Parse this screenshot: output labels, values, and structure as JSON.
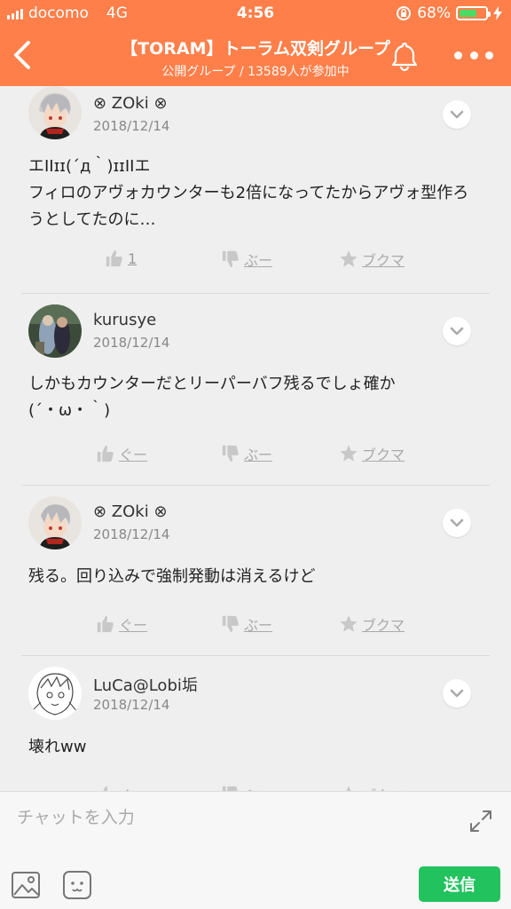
{
  "status_bar": {
    "carrier": "docomo",
    "network": "4G",
    "time": "4:56",
    "battery_percent": "68%",
    "battery_level": 0.68
  },
  "header": {
    "title": "【TORAM】トーラム双剣グループ",
    "subtitle": "公開グループ / 13589人が参加中",
    "back_icon": "chevron-left-icon",
    "bell_icon": "bell-icon",
    "more_icon": "more-dots-icon"
  },
  "posts": [
    {
      "username": "⊗ ZOki ⊗",
      "date": "2018/12/14",
      "message": "エIIɪɪ(´д｀)ɪɪIIエ\nフィロのアヴォカウンターも2倍になってたからアヴォ型作ろうとしてたのに…",
      "like_label": "1",
      "boo_label": "ぶー",
      "bookmark_label": "ブクマ"
    },
    {
      "username": "kurusye",
      "date": "2018/12/14",
      "message": "しかもカウンターだとリーパーバフ残るでしょ確か\n(´・ω・｀)",
      "like_label": "ぐー",
      "boo_label": "ぶー",
      "bookmark_label": "ブクマ"
    },
    {
      "username": "⊗ ZOki ⊗",
      "date": "2018/12/14",
      "message": "残る。回り込みで強制発動は消えるけど",
      "like_label": "ぐー",
      "boo_label": "ぶー",
      "bookmark_label": "ブクマ"
    },
    {
      "username": "LuCa@Lobi垢",
      "date": "2018/12/14",
      "message": "壊れww",
      "like_label": "ぐー",
      "boo_label": "ぶー",
      "bookmark_label": "ブクマ"
    }
  ],
  "input_bar": {
    "placeholder": "チャットを入力",
    "send_label": "送信"
  },
  "colors": {
    "header_bg": "#ff7f4a",
    "send_button": "#22c35e",
    "battery_fill": "#4cd964"
  }
}
